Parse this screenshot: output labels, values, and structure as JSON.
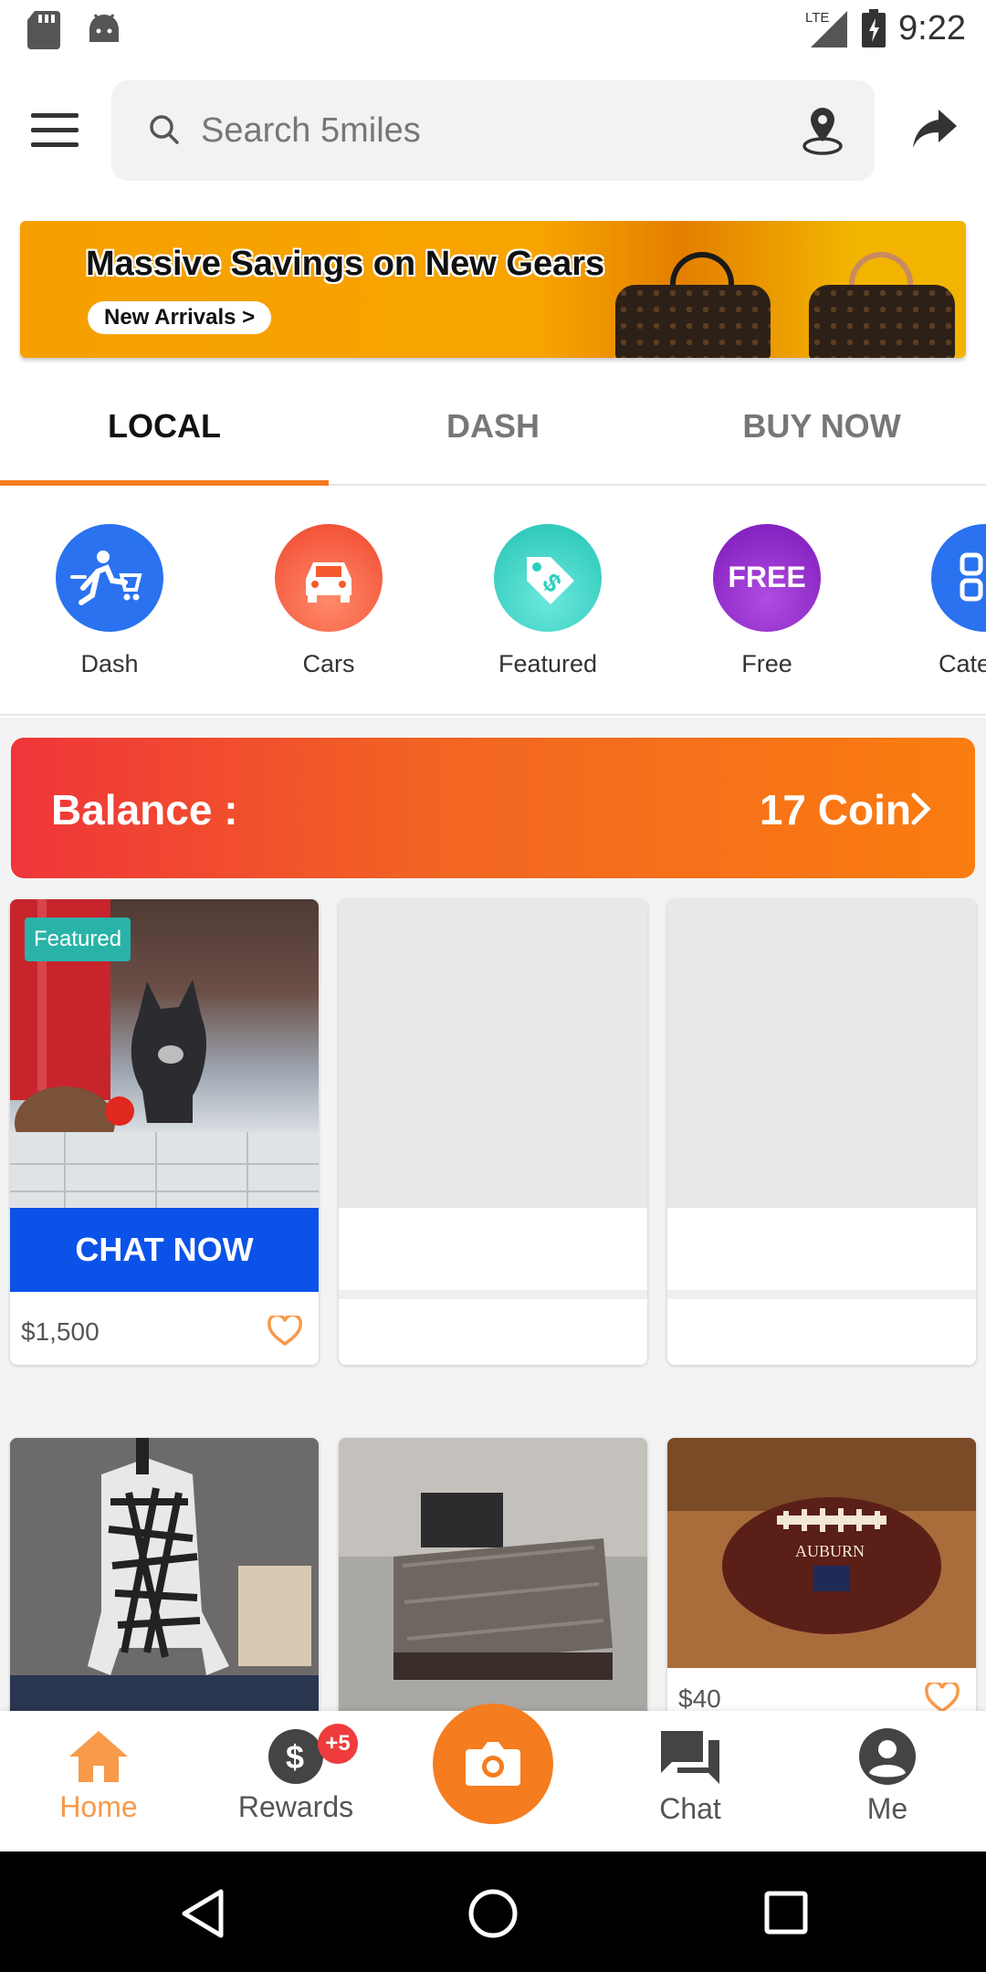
{
  "status_bar": {
    "time": "9:22",
    "network": "LTE",
    "icons": [
      "sd-card-icon",
      "android-icon",
      "signal-icon",
      "battery-icon"
    ]
  },
  "header": {
    "search_placeholder": "Search 5miles",
    "icons": [
      "menu-icon",
      "search-icon",
      "location-icon",
      "share-icon"
    ]
  },
  "banner": {
    "title": "Massive Savings on New Gears",
    "cta": "New Arrivals >"
  },
  "tabs": [
    {
      "label": "LOCAL",
      "active": true
    },
    {
      "label": "DASH",
      "active": false
    },
    {
      "label": "BUY NOW",
      "active": false
    }
  ],
  "categories": [
    {
      "label": "Dash",
      "color": "#2a72f0",
      "icon": "dash-runner-cart-icon"
    },
    {
      "label": "Cars",
      "color": "#f55a2e",
      "icon": "car-icon"
    },
    {
      "label": "Featured",
      "color": "#2ccfc0",
      "icon": "price-tag-icon"
    },
    {
      "label": "Free",
      "color": "#8a22c8",
      "icon": "free-icon",
      "icon_text": "FREE"
    },
    {
      "label": "Cate",
      "color": "#2a72f0",
      "icon": "categories-icon"
    }
  ],
  "balance": {
    "label": "Balance :",
    "value": "17 Coin"
  },
  "listings": [
    {
      "badge": "Featured",
      "cta": "CHAT NOW",
      "price": "$1,500"
    },
    {
      "placeholder": true
    },
    {
      "placeholder": true
    },
    {
      "price": ""
    },
    {
      "price": ""
    },
    {
      "price": "$40"
    }
  ],
  "bottom_nav": {
    "home": "Home",
    "rewards": "Rewards",
    "rewards_badge": "+5",
    "chat": "Chat",
    "me": "Me"
  },
  "colors": {
    "accent": "#f57c1f",
    "chat_now": "#0a52e8",
    "featured_badge": "#29b3a8"
  }
}
